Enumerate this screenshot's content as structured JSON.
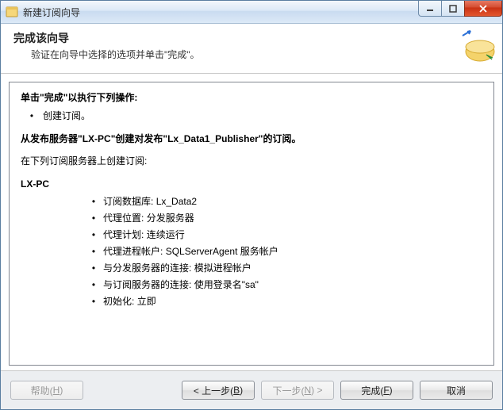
{
  "window": {
    "title": "新建订阅向导"
  },
  "header": {
    "title": "完成该向导",
    "subtitle": "验证在向导中选择的选项并单击\"完成\"。"
  },
  "content": {
    "line_execute": "单击\"完成\"以执行下列操作:",
    "action_create_sub": "创建订阅。",
    "line_from": "从发布服务器\"LX-PC\"创建对发布\"Lx_Data1_Publisher\"的订阅。",
    "line_servers_intro": "在下列订阅服务器上创建订阅:",
    "server_name": "LX-PC",
    "details": [
      {
        "label": "订阅数据库:",
        "value": "Lx_Data2"
      },
      {
        "label": "代理位置:",
        "value": "分发服务器"
      },
      {
        "label": "代理计划:",
        "value": "连续运行"
      },
      {
        "label": "代理进程帐户:",
        "value": "SQLServerAgent 服务帐户"
      },
      {
        "label": "与分发服务器的连接:",
        "value": "模拟进程帐户"
      },
      {
        "label": "与订阅服务器的连接:",
        "value": "使用登录名\"sa\""
      },
      {
        "label": "初始化:",
        "value": "立即"
      }
    ]
  },
  "footer": {
    "help": "帮助(",
    "help_u": "H",
    "help_tail": ")",
    "back": "< 上一步(",
    "back_u": "B",
    "back_tail": ")",
    "next": "下一步(",
    "next_u": "N",
    "next_tail": ") >",
    "finish": "完成(",
    "finish_u": "F",
    "finish_tail": ")",
    "cancel": "取消"
  }
}
